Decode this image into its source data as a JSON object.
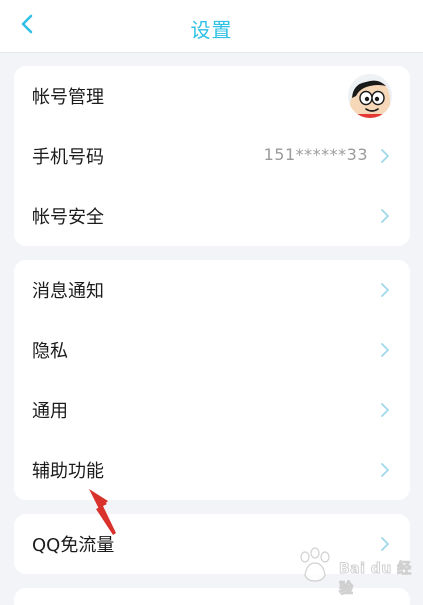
{
  "header": {
    "title": "设置"
  },
  "account_group": {
    "items": [
      {
        "label": "帐号管理"
      },
      {
        "label": "手机号码",
        "value": "151******33"
      },
      {
        "label": "帐号安全"
      }
    ]
  },
  "settings_group": {
    "items": [
      {
        "label": "消息通知"
      },
      {
        "label": "隐私"
      },
      {
        "label": "通用"
      },
      {
        "label": "辅助功能"
      }
    ]
  },
  "qq_group": {
    "items": [
      {
        "label": "QQ免流量"
      }
    ]
  },
  "watermark": {
    "text": "Bai du 经验"
  },
  "colors": {
    "accent": "#2fc1e6",
    "chevron": "#9fd8ea",
    "background": "#f3f4f8",
    "annotation": "#d9312b"
  }
}
